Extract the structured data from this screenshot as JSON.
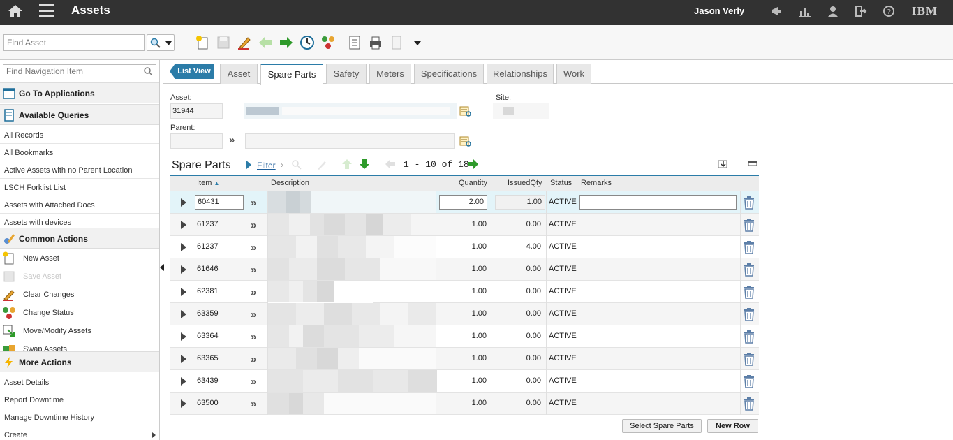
{
  "header": {
    "app_title": "Assets",
    "user_name": "Jason Verly",
    "brand": "IBM"
  },
  "toolbar": {
    "find_asset_placeholder": "Find Asset"
  },
  "sidebar": {
    "nav_find_placeholder": "Find Navigation Item",
    "go_to_applications": "Go To Applications",
    "available_queries": "Available Queries",
    "queries": [
      "All Records",
      "All Bookmarks",
      "Active Assets with no Parent Location",
      "LSCH Forklist List",
      "Assets with Attached Docs",
      "Assets with devices"
    ],
    "common_actions": "Common Actions",
    "common_items": [
      "New Asset",
      "Save Asset",
      "Clear Changes",
      "Change Status",
      "Move/Modify Assets",
      "Swap Assets"
    ],
    "more_actions": "More Actions",
    "more_items": [
      "Asset Details",
      "Report Downtime",
      "Manage Downtime History",
      "Create"
    ]
  },
  "tabs": {
    "list_view": "List View",
    "items": [
      "Asset",
      "Spare Parts",
      "Safety",
      "Meters",
      "Specifications",
      "Relationships",
      "Work"
    ],
    "active": "Spare Parts"
  },
  "form": {
    "asset_label": "Asset:",
    "asset_value": "31944",
    "site_label": "Site:",
    "parent_label": "Parent:"
  },
  "spare_parts": {
    "title": "Spare Parts",
    "filter_label": "Filter",
    "pager": "1 - 10 of 18",
    "columns": {
      "item": "Item",
      "description": "Description",
      "quantity": "Quantity",
      "issued_qty": "IssuedQty",
      "status": "Status",
      "remarks": "Remarks"
    },
    "rows": [
      {
        "item": "60431",
        "quantity": "2.00",
        "issued": "1.00",
        "status": "ACTIVE"
      },
      {
        "item": "61237",
        "quantity": "1.00",
        "issued": "0.00",
        "status": "ACTIVE"
      },
      {
        "item": "61237",
        "quantity": "1.00",
        "issued": "4.00",
        "status": "ACTIVE"
      },
      {
        "item": "61646",
        "quantity": "1.00",
        "issued": "0.00",
        "status": "ACTIVE"
      },
      {
        "item": "62381",
        "quantity": "1.00",
        "issued": "0.00",
        "status": "ACTIVE"
      },
      {
        "item": "63359",
        "quantity": "1.00",
        "issued": "0.00",
        "status": "ACTIVE"
      },
      {
        "item": "63364",
        "quantity": "1.00",
        "issued": "0.00",
        "status": "ACTIVE"
      },
      {
        "item": "63365",
        "quantity": "1.00",
        "issued": "0.00",
        "status": "ACTIVE"
      },
      {
        "item": "63439",
        "quantity": "1.00",
        "issued": "0.00",
        "status": "ACTIVE"
      },
      {
        "item": "63500",
        "quantity": "1.00",
        "issued": "0.00",
        "status": "ACTIVE"
      }
    ],
    "select_button": "Select Spare Parts",
    "new_row_button": "New Row"
  },
  "colors": {
    "topbar": "#323232",
    "accent": "#2b7ca8",
    "selected_row": "#e3f4f9"
  }
}
